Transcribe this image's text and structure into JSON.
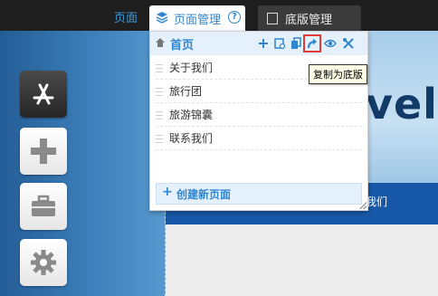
{
  "topbar": {
    "page_tab_label": "页面",
    "active_tab_label": "页面管理",
    "help_glyph": "?",
    "template_tab_label": "底版管理"
  },
  "sidebar_tools": [
    {
      "name": "app-store-icon"
    },
    {
      "name": "add-icon"
    },
    {
      "name": "toolbox-icon"
    },
    {
      "name": "settings-icon"
    }
  ],
  "page_manager": {
    "home_label": "首页",
    "actions": [
      "add-icon",
      "page-icon",
      "copy-icon",
      "copy-as-template-icon",
      "preview-icon",
      "tools-icon"
    ],
    "items": [
      "关于我们",
      "旅行团",
      "旅游锦囊",
      "联系我们"
    ],
    "create_label": "创建新页面",
    "create_glyph": "+"
  },
  "tooltip": "复制为底版",
  "preview": {
    "banner_text": "vel",
    "nav_text": "我们"
  },
  "colors": {
    "accent": "#2f86cf",
    "highlight_border": "#e23b3b",
    "topbar": "#1e1e1e"
  }
}
